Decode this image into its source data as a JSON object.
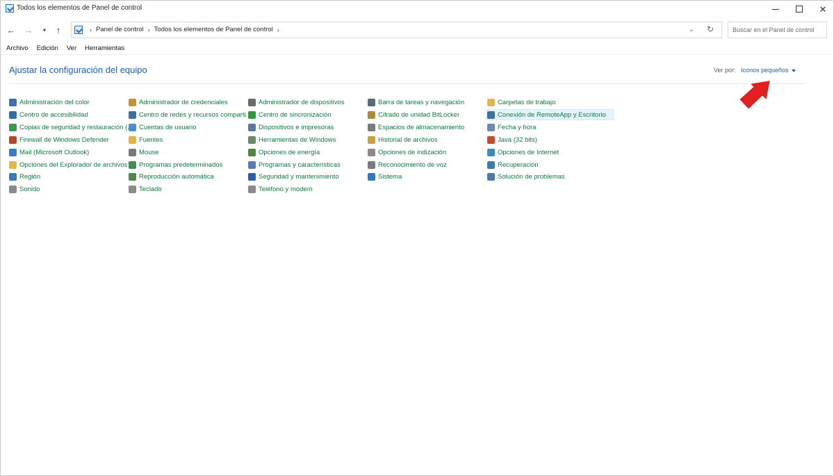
{
  "window": {
    "title": "Todos los elementos de Panel de control",
    "controls": {
      "minimize": "—",
      "maximize": "☐",
      "close": "✕"
    }
  },
  "nav": {
    "back": "←",
    "forward": "→",
    "recent": "▾",
    "up": "↑",
    "breadcrumbs": [
      "Panel de control",
      "Todos los elementos de Panel de control"
    ],
    "crumb_separator": "›",
    "dropdown": "⌄",
    "refresh": "↻",
    "search_placeholder": "Buscar en el Panel de control"
  },
  "menubar": [
    "Archivo",
    "Edición",
    "Ver",
    "Herramientas"
  ],
  "content": {
    "title": "Ajustar la configuración del equipo",
    "view_by_label": "Ver por:",
    "view_by_value": "Iconos pequeños"
  },
  "items": [
    [
      {
        "label": "Administración del color",
        "icon": "color-management-icon",
        "color": "#3a6fb5"
      },
      {
        "label": "Centro de accesibilidad",
        "icon": "accessibility-icon",
        "color": "#2f6fb0"
      },
      {
        "label": "Copias de seguridad y restauración (...",
        "icon": "backup-icon",
        "color": "#3c9a4a"
      },
      {
        "label": "Firewall de Windows Defender",
        "icon": "firewall-icon",
        "color": "#b24a2a"
      },
      {
        "label": "Mail (Microsoft Outlook)",
        "icon": "mail-icon",
        "color": "#3a7bc8"
      },
      {
        "label": "Opciones del Explorador de archivos",
        "icon": "folder-options-icon",
        "color": "#e2b64a"
      },
      {
        "label": "Región",
        "icon": "region-icon",
        "color": "#3a78c0"
      },
      {
        "label": "Sonido",
        "icon": "sound-icon",
        "color": "#8a8a8a"
      }
    ],
    [
      {
        "label": "Administrador de credenciales",
        "icon": "credentials-icon",
        "color": "#c9923a"
      },
      {
        "label": "Centro de redes y recursos comparti...",
        "icon": "network-icon",
        "color": "#3d6fa8"
      },
      {
        "label": "Cuentas de usuario",
        "icon": "user-accounts-icon",
        "color": "#4c8fd0"
      },
      {
        "label": "Fuentes",
        "icon": "fonts-icon",
        "color": "#e0b640"
      },
      {
        "label": "Mouse",
        "icon": "mouse-icon",
        "color": "#7a7a7a"
      },
      {
        "label": "Programas predeterminados",
        "icon": "default-programs-icon",
        "color": "#3f8f4f"
      },
      {
        "label": "Reproducción automática",
        "icon": "autoplay-icon",
        "color": "#4a8a4a"
      },
      {
        "label": "Teclado",
        "icon": "keyboard-icon",
        "color": "#8a8a8a"
      }
    ],
    [
      {
        "label": "Administrador de dispositivos",
        "icon": "device-manager-icon",
        "color": "#6a6a6a"
      },
      {
        "label": "Centro de sincronización",
        "icon": "sync-center-icon",
        "color": "#2e9a3e"
      },
      {
        "label": "Dispositivos e impresoras",
        "icon": "devices-printers-icon",
        "color": "#5a7a9a"
      },
      {
        "label": "Herramientas de Windows",
        "icon": "windows-tools-icon",
        "color": "#6a8a6a"
      },
      {
        "label": "Opciones de energía",
        "icon": "power-options-icon",
        "color": "#4a8a3a"
      },
      {
        "label": "Programas y características",
        "icon": "programs-features-icon",
        "color": "#5a7ab0"
      },
      {
        "label": "Seguridad y mantenimiento",
        "icon": "security-flag-icon",
        "color": "#2a5fb0"
      },
      {
        "label": "Teléfono y módem",
        "icon": "phone-modem-icon",
        "color": "#8a8a8a"
      }
    ],
    [
      {
        "label": "Barra de tareas y navegación",
        "icon": "taskbar-icon",
        "color": "#5a6a7a"
      },
      {
        "label": "Cifrado de unidad BitLocker",
        "icon": "bitlocker-icon",
        "color": "#b08a3a"
      },
      {
        "label": "Espacios de almacenamiento",
        "icon": "storage-spaces-icon",
        "color": "#7a7a7a"
      },
      {
        "label": "Historial de archivos",
        "icon": "file-history-icon",
        "color": "#c8a040"
      },
      {
        "label": "Opciones de indización",
        "icon": "indexing-icon",
        "color": "#8a8a8a"
      },
      {
        "label": "Reconocimiento de voz",
        "icon": "speech-icon",
        "color": "#7a7a7a"
      },
      {
        "label": "Sistema",
        "icon": "system-icon",
        "color": "#2a7ac0"
      }
    ],
    [
      {
        "label": "Carpetas de trabajo",
        "icon": "work-folders-icon",
        "color": "#e2b64a"
      },
      {
        "label": "Conexión de RemoteApp y Escritorio",
        "icon": "remoteapp-icon",
        "color": "#3a6fa8",
        "highlighted": true
      },
      {
        "label": "Fecha y hora",
        "icon": "date-time-icon",
        "color": "#6a8ab0"
      },
      {
        "label": "Java (32 bits)",
        "icon": "java-icon",
        "color": "#c84a2a"
      },
      {
        "label": "Opciones de Internet",
        "icon": "internet-options-icon",
        "color": "#3a8ac8"
      },
      {
        "label": "Recuperación",
        "icon": "recovery-icon",
        "color": "#3a7ab0"
      },
      {
        "label": "Solución de problemas",
        "icon": "troubleshooting-icon",
        "color": "#4a7ab0"
      }
    ]
  ],
  "annotation": {
    "arrow_color": "#e02020"
  }
}
